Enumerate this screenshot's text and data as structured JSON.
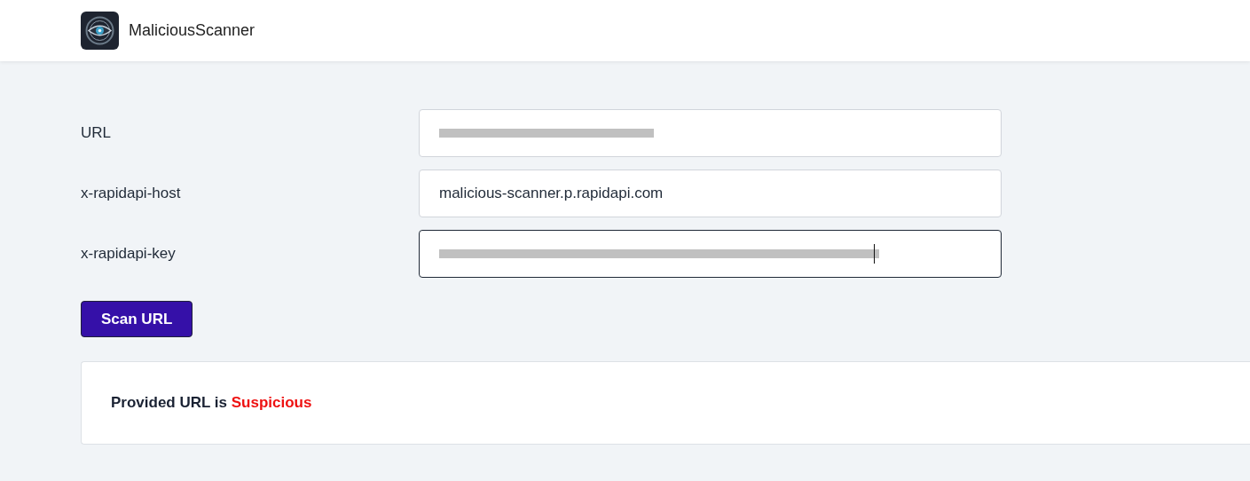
{
  "header": {
    "title": "MaliciousScanner"
  },
  "fields": [
    {
      "label": "URL",
      "redacted": true,
      "focused": false
    },
    {
      "label": "x-rapidapi-host",
      "value": "malicious-scanner.p.rapidapi.com",
      "redacted": false,
      "focused": false
    },
    {
      "label": "x-rapidapi-key",
      "redacted": true,
      "focused": true
    }
  ],
  "button": "Scan URL",
  "result": {
    "label": "Provided URL is",
    "verdict": "Suspicious"
  }
}
